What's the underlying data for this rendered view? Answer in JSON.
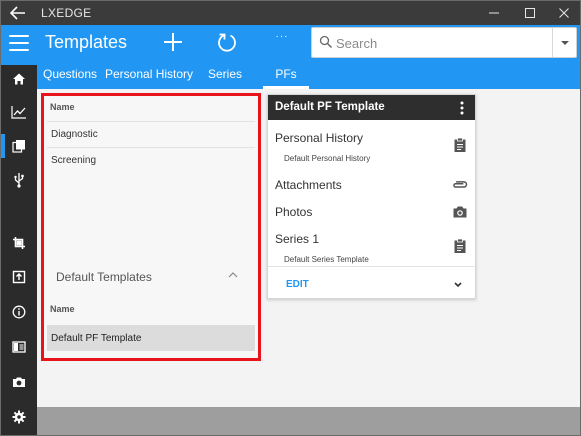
{
  "window": {
    "title": "LXEDGE",
    "icons": {
      "back": "back-arrow-icon",
      "minimize": "minimize-icon",
      "maximize": "maximize-icon",
      "close": "close-icon"
    }
  },
  "header": {
    "title": "Templates",
    "more_label": "···",
    "search": {
      "placeholder": "Search",
      "value": ""
    },
    "tabs": [
      {
        "label": "Questions",
        "active": false
      },
      {
        "label": "Personal History",
        "active": false
      },
      {
        "label": "Series",
        "active": false
      },
      {
        "label": "PFs",
        "active": true
      }
    ],
    "colors": {
      "accent": "#2196f3",
      "rail": "#2b2b2b",
      "highlight": "#e8141b"
    }
  },
  "nav": {
    "items": [
      {
        "icon": "home-icon",
        "selected": false
      },
      {
        "icon": "chart-icon",
        "selected": false
      },
      {
        "icon": "templates-icon",
        "selected": true
      },
      {
        "icon": "usb-icon",
        "selected": false
      },
      {
        "icon": "crop-icon",
        "selected": false
      },
      {
        "icon": "export-icon",
        "selected": false
      },
      {
        "icon": "info-icon",
        "selected": false
      },
      {
        "icon": "document-icon",
        "selected": false
      },
      {
        "icon": "camera-icon",
        "selected": false
      },
      {
        "icon": "settings-icon",
        "selected": false
      }
    ]
  },
  "templates_panel": {
    "name_header": "Name",
    "items": [
      "Diagnostic",
      "Screening"
    ],
    "default_section": {
      "title": "Default Templates",
      "name_header": "Name",
      "items": [
        "Default PF Template"
      ]
    }
  },
  "pf_card": {
    "title": "Default PF Template",
    "rows": [
      {
        "title": "Personal History",
        "subtitle": "Default Personal History",
        "icon": "clipboard-icon"
      },
      {
        "title": "Attachments",
        "subtitle": "",
        "icon": "paperclip-icon"
      },
      {
        "title": "Photos",
        "subtitle": "",
        "icon": "camera-icon"
      },
      {
        "title": "Series 1",
        "subtitle": "Default Series Template",
        "icon": "clipboard-icon"
      }
    ],
    "edit_label": "EDIT"
  }
}
